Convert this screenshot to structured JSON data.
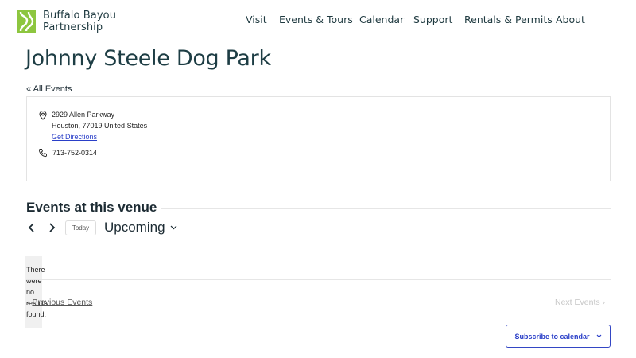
{
  "brand": {
    "name_line1": "Buffalo Bayou",
    "name_line2": "Partnership",
    "logo_color": "#8dc63f"
  },
  "nav": {
    "items": [
      {
        "label": "Visit"
      },
      {
        "label": "Events & Tours"
      },
      {
        "label": "Calendar"
      },
      {
        "label": "Support"
      },
      {
        "label": "Rentals & Permits"
      },
      {
        "label": "About"
      }
    ]
  },
  "page": {
    "title": "Johnny Steele Dog Park",
    "back_link": "« All Events"
  },
  "venue": {
    "address_line1": "2929 Allen Parkway",
    "address_line2": "Houston, 77019 United States",
    "directions_label": "Get Directions",
    "phone": "713-752-0314",
    "address_icon": "map-pin-icon",
    "phone_icon": "phone-icon"
  },
  "events": {
    "heading": "Events at this venue",
    "today_label": "Today",
    "view_label": "Upcoming",
    "no_results": "There were no results found.",
    "previous_label": "Previous Events",
    "next_label": "Next Events",
    "subscribe_label": "Subscribe to calendar"
  },
  "colors": {
    "accent_blue": "#2a3fc8",
    "heading_teal": "#1d3d44"
  }
}
